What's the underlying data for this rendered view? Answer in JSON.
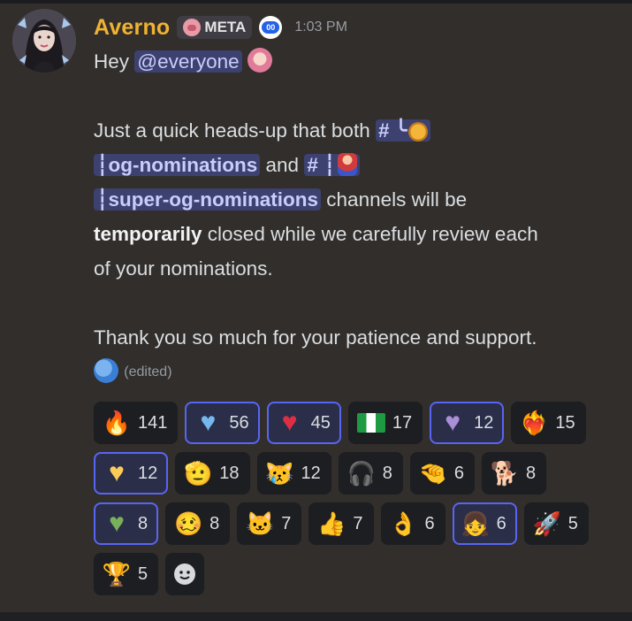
{
  "message": {
    "username": "Averno",
    "role_tag": "META",
    "app_badge": "00",
    "timestamp": "1:03 PM",
    "line1_text": "Hey ",
    "mention": "@everyone",
    "body": {
      "l1_text": "Just a quick heads-up that both ",
      "channel1_hash": "# ╰",
      "channel1_name": "┆og-nominations",
      "and": " and ",
      "channel2_hash": "# ┆",
      "channel2_name": "┆super-og-nominations",
      "l3_rest": " channels will be",
      "bold_word": "temporarily",
      "l4_rest": " closed while we carefully review each",
      "l5": "of your nominations.",
      "thanks": "Thank you so much for your patience and support.",
      "edited": "(edited)"
    }
  },
  "reactions": [
    {
      "icon": "fire-icon",
      "glyph": "🔥",
      "count": "141",
      "me": false
    },
    {
      "icon": "blue-heart-icon",
      "glyph": "♥",
      "color": "#74b8f0",
      "count": "56",
      "me": true
    },
    {
      "icon": "red-heart-icon",
      "glyph": "♥",
      "color": "#dd2e44",
      "count": "45",
      "me": true
    },
    {
      "icon": "nigeria-flag-icon",
      "glyph": "",
      "count": "17",
      "me": false
    },
    {
      "icon": "purple-heart-icon",
      "glyph": "♥",
      "color": "#aa8ed6",
      "count": "12",
      "me": true
    },
    {
      "icon": "fire-heart-icon",
      "glyph": "❤‍🔥",
      "count": "15",
      "me": false
    },
    {
      "icon": "yellow-heart-icon",
      "glyph": "♥",
      "color": "#fdcb58",
      "count": "12",
      "me": true
    },
    {
      "icon": "salute-face-icon",
      "glyph": "🫡",
      "count": "18",
      "me": false
    },
    {
      "icon": "crying-cat-icon",
      "glyph": "😿",
      "count": "12",
      "me": false
    },
    {
      "icon": "headset-guy-icon",
      "glyph": "🎧",
      "count": "8",
      "me": false
    },
    {
      "icon": "pinch-hand-icon",
      "glyph": "🤏",
      "count": "6",
      "me": false
    },
    {
      "icon": "doge-icon",
      "glyph": "🐕",
      "count": "8",
      "me": false
    },
    {
      "icon": "green-heart-icon",
      "glyph": "♥",
      "color": "#78b159",
      "count": "8",
      "me": true
    },
    {
      "icon": "pepe-face-icon",
      "glyph": "🥴",
      "count": "8",
      "me": false
    },
    {
      "icon": "cat-face-icon",
      "glyph": "🐱",
      "count": "7",
      "me": false
    },
    {
      "icon": "thumbs-up-icon",
      "glyph": "👍",
      "count": "7",
      "me": false
    },
    {
      "icon": "ok-hand-icon",
      "glyph": "👌",
      "count": "6",
      "me": false
    },
    {
      "icon": "anime-girl-icon",
      "glyph": "👧",
      "count": "6",
      "me": true
    },
    {
      "icon": "rocket-icon",
      "glyph": "🚀",
      "count": "5",
      "me": false
    },
    {
      "icon": "trophy-icon",
      "glyph": "🏆",
      "count": "5",
      "me": false
    }
  ],
  "colors": {
    "accent": "#5865f2",
    "username": "#f0b232",
    "mention_bg": "#3c4170"
  }
}
